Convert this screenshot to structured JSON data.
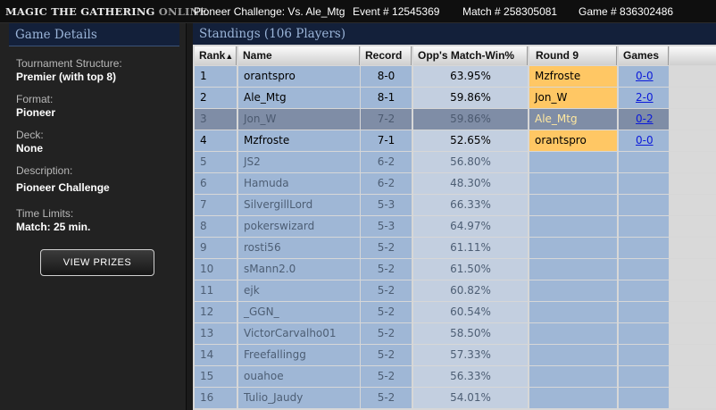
{
  "titlebar": {
    "logo_main": "MAGIC THE GATHERING",
    "logo_online": "ONLINE",
    "event_title": "Pioneer Challenge: Vs. Ale_Mtg",
    "event_number": "Event # 12545369",
    "match_number": "Match # 258305081",
    "game_number": "Game # 836302486"
  },
  "details": {
    "title": "Game Details",
    "structure_label": "Tournament Structure:",
    "structure_value": "Premier (with top 8)",
    "format_label": "Format:",
    "format_value": "Pioneer",
    "deck_label": "Deck:",
    "deck_value": "None",
    "description_label": "Description:",
    "description_value": "Pioneer Challenge",
    "time_label": "Time Limits:",
    "time_value": "Match: 25 min.",
    "view_prizes": "VIEW PRIZES"
  },
  "standings": {
    "title": "Standings (106 Players)",
    "columns": {
      "rank": "Rank",
      "sort_indicator": "▲",
      "name": "Name",
      "record": "Record",
      "opp_match_win": "Opp's Match-Win%",
      "round": "Round 9",
      "games": "Games"
    },
    "rows": [
      {
        "rank": "1",
        "name": "orantspro",
        "record": "8-0",
        "omw": "63.95%",
        "opponent": "Mzfroste",
        "games": "0-0"
      },
      {
        "rank": "2",
        "name": "Ale_Mtg",
        "record": "8-1",
        "omw": "59.86%",
        "opponent": "Jon_W",
        "games": "2-0"
      },
      {
        "rank": "3",
        "name": "Jon_W",
        "record": "7-2",
        "omw": "59.86%",
        "opponent": "Ale_Mtg",
        "games": "0-2"
      },
      {
        "rank": "4",
        "name": "Mzfroste",
        "record": "7-1",
        "omw": "52.65%",
        "opponent": "orantspro",
        "games": "0-0"
      },
      {
        "rank": "5",
        "name": "JS2",
        "record": "6-2",
        "omw": "56.80%",
        "opponent": "",
        "games": ""
      },
      {
        "rank": "6",
        "name": "Hamuda",
        "record": "6-2",
        "omw": "48.30%",
        "opponent": "",
        "games": ""
      },
      {
        "rank": "7",
        "name": "SilvergillLord",
        "record": "5-3",
        "omw": "66.33%",
        "opponent": "",
        "games": ""
      },
      {
        "rank": "8",
        "name": "pokerswizard",
        "record": "5-3",
        "omw": "64.97%",
        "opponent": "",
        "games": ""
      },
      {
        "rank": "9",
        "name": "rosti56",
        "record": "5-2",
        "omw": "61.11%",
        "opponent": "",
        "games": ""
      },
      {
        "rank": "10",
        "name": "sMann2.0",
        "record": "5-2",
        "omw": "61.50%",
        "opponent": "",
        "games": ""
      },
      {
        "rank": "11",
        "name": "ejk",
        "record": "5-2",
        "omw": "60.82%",
        "opponent": "",
        "games": ""
      },
      {
        "rank": "12",
        "name": "_GGN_",
        "record": "5-2",
        "omw": "60.54%",
        "opponent": "",
        "games": ""
      },
      {
        "rank": "13",
        "name": "VictorCarvalho01",
        "record": "5-2",
        "omw": "58.50%",
        "opponent": "",
        "games": ""
      },
      {
        "rank": "14",
        "name": "Freefallingg",
        "record": "5-2",
        "omw": "57.33%",
        "opponent": "",
        "games": ""
      },
      {
        "rank": "15",
        "name": "ouahoe",
        "record": "5-2",
        "omw": "56.33%",
        "opponent": "",
        "games": ""
      },
      {
        "rank": "16",
        "name": "Tulio_Jaudy",
        "record": "5-2",
        "omw": "54.01%",
        "opponent": "",
        "games": ""
      }
    ]
  },
  "colors": {
    "header_bg": "#13203a",
    "header_text": "#9ab4d8",
    "opponent_highlight": "#ffc764",
    "link": "#0b1ad9",
    "selected_row": "#7f8da6"
  }
}
